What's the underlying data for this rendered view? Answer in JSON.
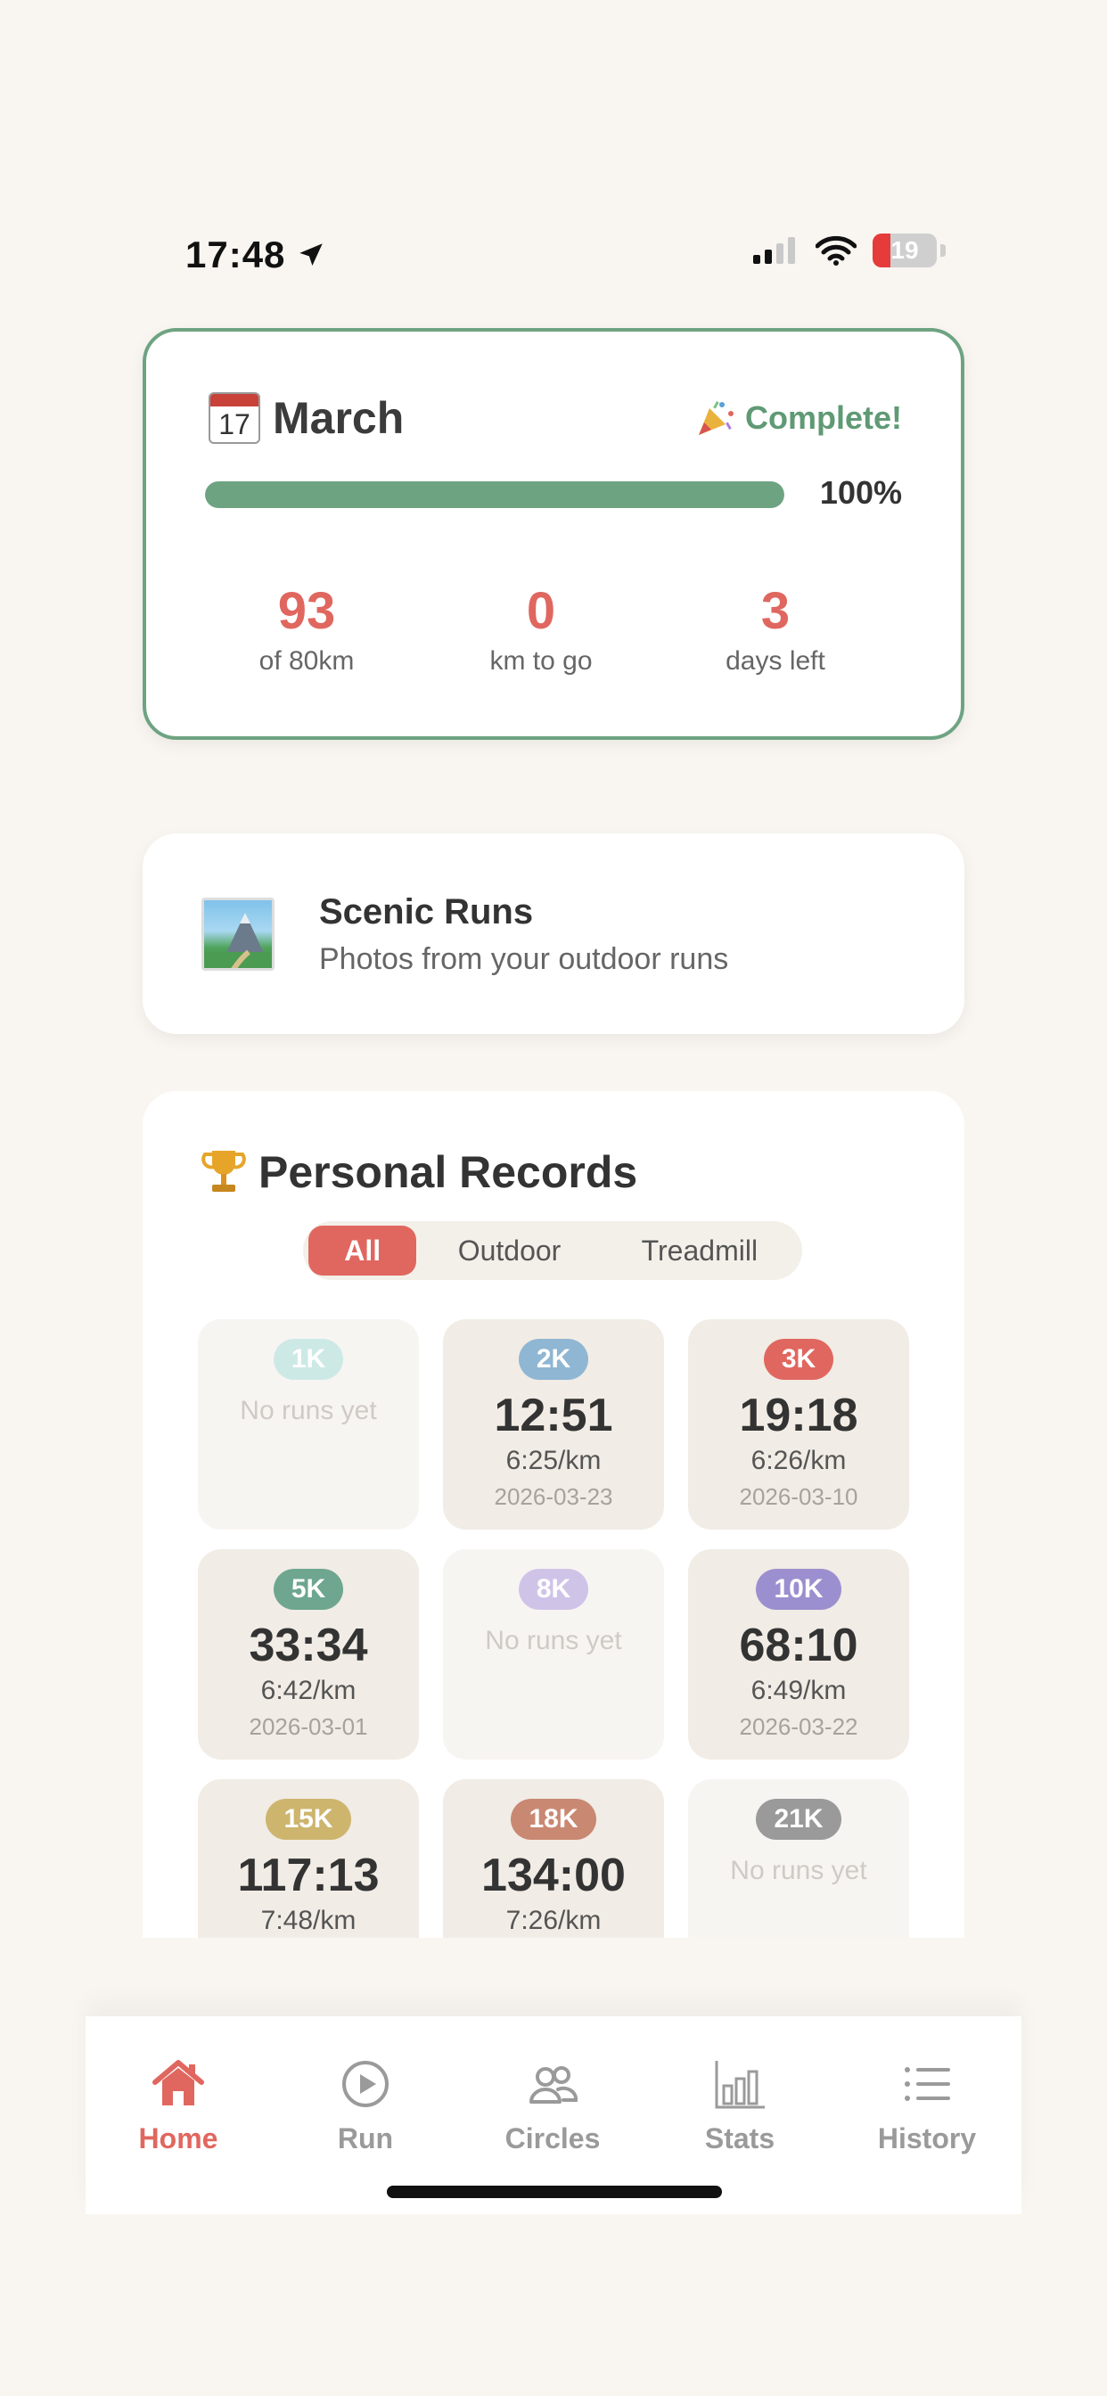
{
  "status_bar": {
    "time": "17:48",
    "battery": "19"
  },
  "month_card": {
    "month": "March",
    "calendar_day": "17",
    "status": "Complete!",
    "progress_percent_label": "100%",
    "progress_fraction": 1.0,
    "stats": [
      {
        "value": "93",
        "label": "of 80km"
      },
      {
        "value": "0",
        "label": "km to go"
      },
      {
        "value": "3",
        "label": "days left"
      }
    ]
  },
  "scenic": {
    "title": "Scenic Runs",
    "subtitle": "Photos from your outdoor runs"
  },
  "records": {
    "title": "Personal Records",
    "filters": [
      "All",
      "Outdoor",
      "Treadmill"
    ],
    "active_filter": "All",
    "tiles": [
      {
        "distance": "1K",
        "color": "#cde9e6",
        "empty": true,
        "none_text": "No runs yet"
      },
      {
        "distance": "2K",
        "color": "#8fb6d3",
        "time": "12:51",
        "pace": "6:25/km",
        "date": "2026-03-23"
      },
      {
        "distance": "3K",
        "color": "#e0675f",
        "time": "19:18",
        "pace": "6:26/km",
        "date": "2026-03-10"
      },
      {
        "distance": "5K",
        "color": "#6ea68f",
        "time": "33:34",
        "pace": "6:42/km",
        "date": "2026-03-01"
      },
      {
        "distance": "8K",
        "color": "#cfc3e8",
        "empty": true,
        "none_text": "No runs yet"
      },
      {
        "distance": "10K",
        "color": "#9c8fcf",
        "time": "68:10",
        "pace": "6:49/km",
        "date": "2026-03-22"
      },
      {
        "distance": "15K",
        "color": "#cdb56e",
        "time": "117:13",
        "pace": "7:48/km",
        "date": ""
      },
      {
        "distance": "18K",
        "color": "#c98872",
        "time": "134:00",
        "pace": "7:26/km",
        "date": ""
      },
      {
        "distance": "21K",
        "color": "#9a9a9a",
        "empty": true,
        "none_text": "No runs yet"
      }
    ]
  },
  "tabbar": {
    "tabs": [
      {
        "label": "Home",
        "icon": "house-icon",
        "active": true
      },
      {
        "label": "Run",
        "icon": "play-circle-icon"
      },
      {
        "label": "Circles",
        "icon": "people-icon"
      },
      {
        "label": "Stats",
        "icon": "bar-chart-icon"
      },
      {
        "label": "History",
        "icon": "list-icon"
      }
    ]
  },
  "colors": {
    "accent": "#e0675f",
    "green": "#6ea382",
    "background": "#f9f6f1"
  }
}
